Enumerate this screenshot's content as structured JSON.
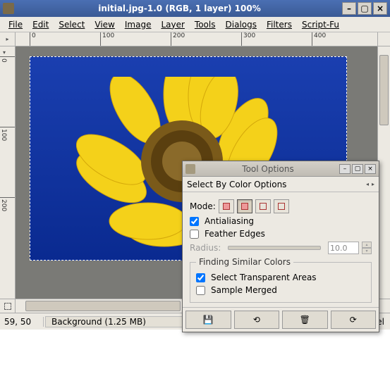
{
  "window": {
    "title": "initial.jpg-1.0 (RGB, 1 layer) 100%"
  },
  "menu": {
    "items": [
      "File",
      "Edit",
      "Select",
      "View",
      "Image",
      "Layer",
      "Tools",
      "Dialogs",
      "Filters",
      "Script-Fu"
    ]
  },
  "ruler": {
    "top": [
      "0",
      "100",
      "200",
      "300",
      "400"
    ],
    "left": [
      "0",
      "100",
      "200"
    ]
  },
  "status": {
    "coords": "59, 50",
    "layer": "Background (1.25 MB)",
    "cancel": "ancel"
  },
  "dialog": {
    "title": "Tool Options",
    "tab": "Select By Color Options",
    "mode_label": "Mode:",
    "antialiasing": "Antialiasing",
    "feather": "Feather Edges",
    "radius_label": "Radius:",
    "radius_value": "10.0",
    "group_title": "Finding Similar Colors",
    "select_transparent": "Select Transparent Areas",
    "sample_merged": "Sample Merged",
    "checks": {
      "antialiasing": true,
      "feather": false,
      "select_transparent": true,
      "sample_merged": false
    }
  }
}
